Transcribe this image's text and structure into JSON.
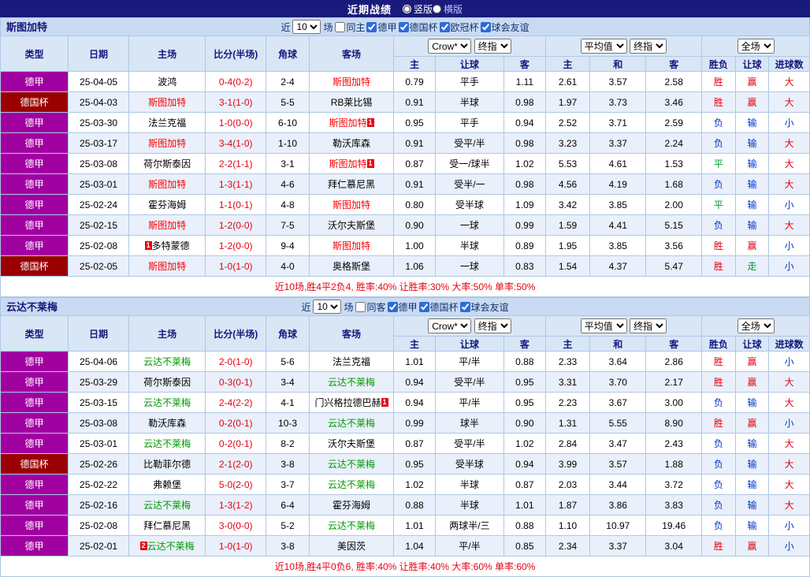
{
  "top_bar": {
    "title": "近期战绩",
    "radios": [
      {
        "label": "竖版",
        "selected": true
      },
      {
        "label": "横版",
        "selected": false
      }
    ]
  },
  "filter": {
    "prefix": "近",
    "count": "10",
    "suffix": "场"
  },
  "table_header": {
    "static_cols": [
      "类型",
      "日期",
      "主场",
      "比分(半场)",
      "角球",
      "客场"
    ],
    "selects": {
      "book": "Crow*",
      "stage": "终指",
      "avg": "平均值",
      "stage2": "终指",
      "fulltime": "全场"
    },
    "sub_cols": [
      "主",
      "让球",
      "客",
      "主",
      "和",
      "客",
      "胜负",
      "让球",
      "进球数"
    ]
  },
  "result_colors": {
    "胜": "#e60012",
    "平": "#009933",
    "负": "#0033cc",
    "赢": "#e60012",
    "输": "#0033cc",
    "走": "#009933",
    "大": "#e60012",
    "小": "#0033cc"
  },
  "league_colors": {
    "德甲": "#a100a1",
    "德国杯": "#9a0000"
  },
  "sections": [
    {
      "team": "斯图加特",
      "focus_color": "#ff0000",
      "filter_checkboxes": [
        {
          "label": "同主",
          "checked": false
        },
        {
          "label": "德甲",
          "checked": true
        },
        {
          "label": "德国杯",
          "checked": true
        },
        {
          "label": "欧冠杯",
          "checked": true
        },
        {
          "label": "球会友谊",
          "checked": true
        }
      ],
      "rows": [
        {
          "league": "德甲",
          "date": "25-04-05",
          "home": "波鸿",
          "score": "0-4(0-2)",
          "corners": "2-4",
          "away": "斯图加特",
          "away_focus": true,
          "odds": [
            "0.79",
            "平手",
            "1.11",
            "2.61",
            "3.57",
            "2.58"
          ],
          "results": [
            "胜",
            "赢",
            "大"
          ]
        },
        {
          "league": "德国杯",
          "date": "25-04-03",
          "home": "斯图加特",
          "home_focus": true,
          "score": "3-1(1-0)",
          "corners": "5-5",
          "away": "RB莱比锡",
          "odds": [
            "0.91",
            "半球",
            "0.98",
            "1.97",
            "3.73",
            "3.46"
          ],
          "results": [
            "胜",
            "赢",
            "大"
          ]
        },
        {
          "league": "德甲",
          "date": "25-03-30",
          "home": "法兰克福",
          "score": "1-0(0-0)",
          "corners": "6-10",
          "away": "斯图加特",
          "away_focus": true,
          "away_badge": {
            "text": "1",
            "pos": "post"
          },
          "odds": [
            "0.95",
            "平手",
            "0.94",
            "2.52",
            "3.71",
            "2.59"
          ],
          "results": [
            "负",
            "输",
            "小"
          ]
        },
        {
          "league": "德甲",
          "date": "25-03-17",
          "home": "斯图加特",
          "home_focus": true,
          "score": "3-4(1-0)",
          "corners": "1-10",
          "away": "勒沃库森",
          "odds": [
            "0.91",
            "受平/半",
            "0.98",
            "3.23",
            "3.37",
            "2.24"
          ],
          "results": [
            "负",
            "输",
            "大"
          ]
        },
        {
          "league": "德甲",
          "date": "25-03-08",
          "home": "荷尔斯泰因",
          "score": "2-2(1-1)",
          "corners": "3-1",
          "away": "斯图加特",
          "away_focus": true,
          "away_badge": {
            "text": "1",
            "pos": "post"
          },
          "odds": [
            "0.87",
            "受一/球半",
            "1.02",
            "5.53",
            "4.61",
            "1.53"
          ],
          "results": [
            "平",
            "输",
            "大"
          ]
        },
        {
          "league": "德甲",
          "date": "25-03-01",
          "home": "斯图加特",
          "home_focus": true,
          "score": "1-3(1-1)",
          "corners": "4-6",
          "away": "拜仁慕尼黑",
          "odds": [
            "0.91",
            "受半/一",
            "0.98",
            "4.56",
            "4.19",
            "1.68"
          ],
          "results": [
            "负",
            "输",
            "大"
          ]
        },
        {
          "league": "德甲",
          "date": "25-02-24",
          "home": "霍芬海姆",
          "score": "1-1(0-1)",
          "corners": "4-8",
          "away": "斯图加特",
          "away_focus": true,
          "odds": [
            "0.80",
            "受半球",
            "1.09",
            "3.42",
            "3.85",
            "2.00"
          ],
          "results": [
            "平",
            "输",
            "小"
          ]
        },
        {
          "league": "德甲",
          "date": "25-02-15",
          "home": "斯图加特",
          "home_focus": true,
          "score": "1-2(0-0)",
          "corners": "7-5",
          "away": "沃尔夫斯堡",
          "odds": [
            "0.90",
            "一球",
            "0.99",
            "1.59",
            "4.41",
            "5.15"
          ],
          "results": [
            "负",
            "输",
            "大"
          ]
        },
        {
          "league": "德甲",
          "date": "25-02-08",
          "home": "多特蒙德",
          "home_badge": {
            "text": "1",
            "pos": "pre"
          },
          "score": "1-2(0-0)",
          "corners": "9-4",
          "away": "斯图加特",
          "away_focus": true,
          "odds": [
            "1.00",
            "半球",
            "0.89",
            "1.95",
            "3.85",
            "3.56"
          ],
          "results": [
            "胜",
            "赢",
            "小"
          ]
        },
        {
          "league": "德国杯",
          "date": "25-02-05",
          "home": "斯图加特",
          "home_focus": true,
          "score": "1-0(1-0)",
          "corners": "4-0",
          "away": "奥格斯堡",
          "odds": [
            "1.06",
            "一球",
            "0.83",
            "1.54",
            "4.37",
            "5.47"
          ],
          "results": [
            "胜",
            "走",
            "小"
          ]
        }
      ],
      "summary": "近10场,胜4平2负4, 胜率:40% 让胜率:30% 大率:50% 单率:50%"
    },
    {
      "team": "云达不莱梅",
      "focus_color": "#009900",
      "filter_checkboxes": [
        {
          "label": "同客",
          "checked": false
        },
        {
          "label": "德甲",
          "checked": true
        },
        {
          "label": "德国杯",
          "checked": true
        },
        {
          "label": "球会友谊",
          "checked": true
        }
      ],
      "rows": [
        {
          "league": "德甲",
          "date": "25-04-06",
          "home": "云达不莱梅",
          "home_focus": true,
          "score": "2-0(1-0)",
          "corners": "5-6",
          "away": "法兰克福",
          "odds": [
            "1.01",
            "平/半",
            "0.88",
            "2.33",
            "3.64",
            "2.86"
          ],
          "results": [
            "胜",
            "赢",
            "小"
          ]
        },
        {
          "league": "德甲",
          "date": "25-03-29",
          "home": "荷尔斯泰因",
          "score": "0-3(0-1)",
          "corners": "3-4",
          "away": "云达不莱梅",
          "away_focus": true,
          "odds": [
            "0.94",
            "受平/半",
            "0.95",
            "3.31",
            "3.70",
            "2.17"
          ],
          "results": [
            "胜",
            "赢",
            "大"
          ]
        },
        {
          "league": "德甲",
          "date": "25-03-15",
          "home": "云达不莱梅",
          "home_focus": true,
          "score": "2-4(2-2)",
          "corners": "4-1",
          "away": "门兴格拉德巴赫",
          "away_badge": {
            "text": "1",
            "pos": "post"
          },
          "odds": [
            "0.94",
            "平/半",
            "0.95",
            "2.23",
            "3.67",
            "3.00"
          ],
          "results": [
            "负",
            "输",
            "大"
          ]
        },
        {
          "league": "德甲",
          "date": "25-03-08",
          "home": "勒沃库森",
          "score": "0-2(0-1)",
          "corners": "10-3",
          "away": "云达不莱梅",
          "away_focus": true,
          "odds": [
            "0.99",
            "球半",
            "0.90",
            "1.31",
            "5.55",
            "8.90"
          ],
          "results": [
            "胜",
            "赢",
            "小"
          ]
        },
        {
          "league": "德甲",
          "date": "25-03-01",
          "home": "云达不莱梅",
          "home_focus": true,
          "score": "0-2(0-1)",
          "corners": "8-2",
          "away": "沃尔夫斯堡",
          "odds": [
            "0.87",
            "受平/半",
            "1.02",
            "2.84",
            "3.47",
            "2.43"
          ],
          "results": [
            "负",
            "输",
            "大"
          ]
        },
        {
          "league": "德国杯",
          "date": "25-02-26",
          "home": "比勒菲尔德",
          "score": "2-1(2-0)",
          "corners": "3-8",
          "away": "云达不莱梅",
          "away_focus": true,
          "odds": [
            "0.95",
            "受半球",
            "0.94",
            "3.99",
            "3.57",
            "1.88"
          ],
          "results": [
            "负",
            "输",
            "大"
          ]
        },
        {
          "league": "德甲",
          "date": "25-02-22",
          "home": "弗赖堡",
          "score": "5-0(2-0)",
          "corners": "3-7",
          "away": "云达不莱梅",
          "away_focus": true,
          "odds": [
            "1.02",
            "半球",
            "0.87",
            "2.03",
            "3.44",
            "3.72"
          ],
          "results": [
            "负",
            "输",
            "大"
          ]
        },
        {
          "league": "德甲",
          "date": "25-02-16",
          "home": "云达不莱梅",
          "home_focus": true,
          "score": "1-3(1-2)",
          "corners": "6-4",
          "away": "霍芬海姆",
          "odds": [
            "0.88",
            "半球",
            "1.01",
            "1.87",
            "3.86",
            "3.83"
          ],
          "results": [
            "负",
            "输",
            "大"
          ]
        },
        {
          "league": "德甲",
          "date": "25-02-08",
          "home": "拜仁慕尼黑",
          "score": "3-0(0-0)",
          "corners": "5-2",
          "away": "云达不莱梅",
          "away_focus": true,
          "odds": [
            "1.01",
            "两球半/三",
            "0.88",
            "1.10",
            "10.97",
            "19.46"
          ],
          "results": [
            "负",
            "输",
            "小"
          ]
        },
        {
          "league": "德甲",
          "date": "25-02-01",
          "home": "云达不莱梅",
          "home_focus": true,
          "home_badge": {
            "text": "2",
            "pos": "pre"
          },
          "score": "1-0(1-0)",
          "corners": "3-8",
          "away": "美因茨",
          "odds": [
            "1.04",
            "平/半",
            "0.85",
            "2.34",
            "3.37",
            "3.04"
          ],
          "results": [
            "胜",
            "赢",
            "小"
          ]
        }
      ],
      "summary": "近10场,胜4平0负6, 胜率:40% 让胜率:40% 大率:60% 单率:60%"
    }
  ]
}
